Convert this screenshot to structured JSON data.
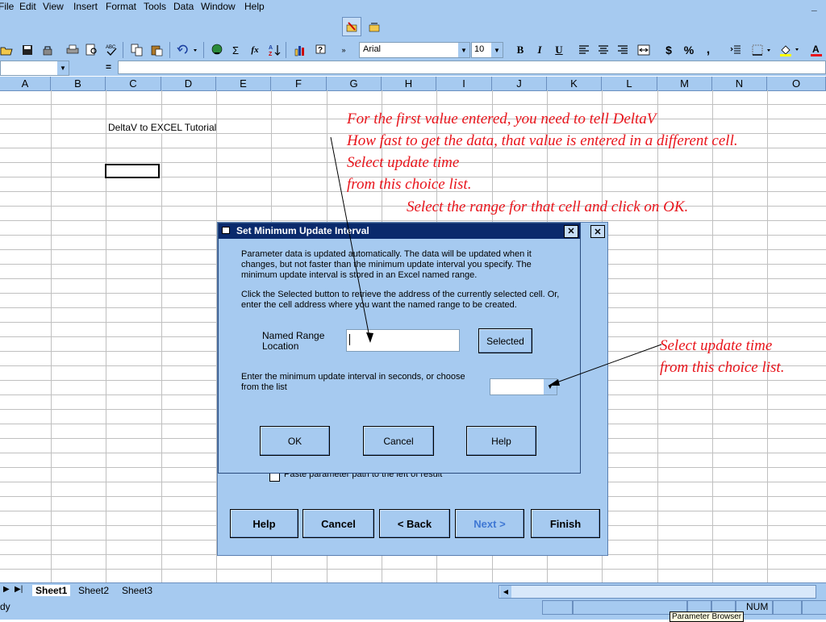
{
  "menu": {
    "items": [
      "File",
      "Edit",
      "View",
      "Insert",
      "Format",
      "Tools",
      "Data",
      "Window",
      "Help"
    ],
    "min_button": "_"
  },
  "toolbar": {
    "font_name": "Arial",
    "font_size": "10",
    "bold": "B",
    "italic": "I",
    "underline": "U",
    "currency": "$",
    "percent": "%",
    "comma": ",",
    "sum": "Σ",
    "fx": "fx"
  },
  "formula_bar": {
    "equals": "="
  },
  "columns": [
    "A",
    "B",
    "C",
    "D",
    "E",
    "F",
    "G",
    "H",
    "I",
    "J",
    "K",
    "L",
    "M",
    "N",
    "O"
  ],
  "cells": {
    "c2": "DeltaV to EXCEL Tutorial"
  },
  "annotations": {
    "top": [
      "For the first value entered, you need to tell DeltaV",
      "How fast to get the data, that value is entered in a different cell.",
      "Select update time",
      "from this choice list."
    ],
    "range": "Select the range for that cell and click on OK.",
    "right": [
      "Select update time",
      "from this choice list."
    ]
  },
  "wizard": {
    "checkbox_label": "Paste parameter path to the left of result",
    "buttons": {
      "help": "Help",
      "cancel": "Cancel",
      "back": "< Back",
      "next": "Next >",
      "finish": "Finish"
    }
  },
  "dialog": {
    "title": "Set Minimum Update Interval",
    "para1": "Parameter data is updated automatically.  The data will be updated when it changes, but not faster than the minimum update interval you specify.  The minimum update interval is stored in an Excel named range.",
    "para2": "Click the Selected button to retrieve the address of the currently selected cell.  Or, enter the cell address where you want the named range to be created.",
    "named_range_label": "Named Range Location",
    "named_range_value": "",
    "selected_button": "Selected",
    "interval_label": "Enter the minimum update interval in seconds, or choose from the list",
    "interval_value": "",
    "ok": "OK",
    "cancel": "Cancel",
    "help": "Help"
  },
  "sheet_tabs": [
    "Sheet1",
    "Sheet2",
    "Sheet3"
  ],
  "status": {
    "left": "dy",
    "num": "NUM",
    "tooltip": "Parameter Browser"
  },
  "colors": {
    "chrome": "#a6caf0",
    "annotation": "#e8141b",
    "titlebar": "#0a2a6c"
  }
}
